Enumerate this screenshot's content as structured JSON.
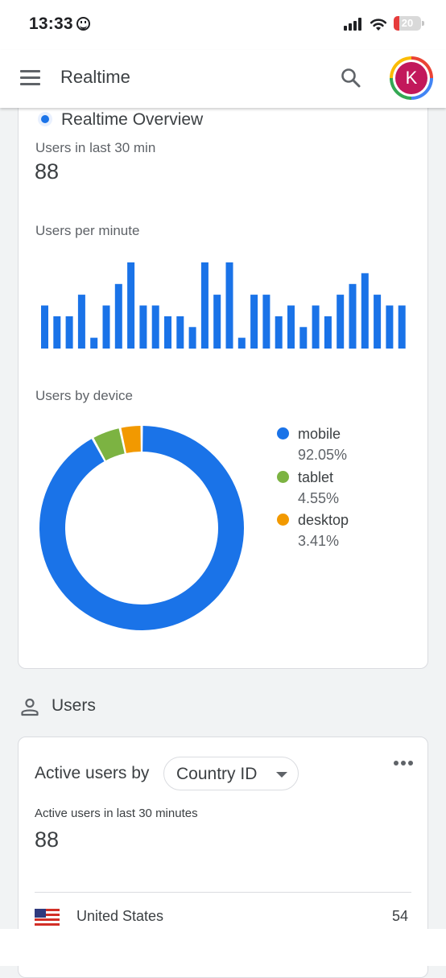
{
  "status_bar": {
    "time": "13:33",
    "battery": "20"
  },
  "app_bar": {
    "title": "Realtime",
    "avatar_letter": "K"
  },
  "overview": {
    "title": "Realtime Overview",
    "users_label": "Users in last 30 min",
    "users_value": "88",
    "per_minute_label": "Users per minute",
    "device_label": "Users by device"
  },
  "chart_data": [
    {
      "type": "bar",
      "title": "Users per minute",
      "values": [
        4,
        3,
        3,
        5,
        1,
        4,
        6,
        8,
        4,
        4,
        3,
        3,
        2,
        8,
        5,
        8,
        1,
        5,
        5,
        3,
        4,
        2,
        4,
        3,
        5,
        6,
        7,
        5,
        4,
        4
      ],
      "ylim": [
        0,
        8
      ]
    },
    {
      "type": "pie",
      "title": "Users by device",
      "categories": [
        "mobile",
        "tablet",
        "desktop"
      ],
      "values": [
        92.05,
        4.55,
        3.41
      ],
      "labels": [
        "92.05%",
        "4.55%",
        "3.41%"
      ],
      "colors": [
        "#1a73e8",
        "#7cb342",
        "#f29900"
      ]
    }
  ],
  "users_section": {
    "title": "Users"
  },
  "active_users": {
    "title": "Active users by",
    "dropdown": "Country ID",
    "subtitle": "Active users in last 30 minutes",
    "value": "88",
    "rows": [
      {
        "country": "United States",
        "value": "54"
      }
    ]
  }
}
